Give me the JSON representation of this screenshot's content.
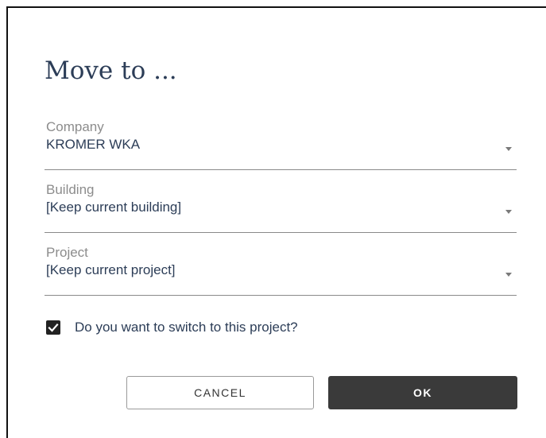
{
  "dialog": {
    "title": "Move to ..."
  },
  "fields": [
    {
      "label": "Company",
      "value": "KROMER WKA",
      "icon": "dropdown-arrow"
    },
    {
      "label": "Building",
      "value": "[Keep current building]",
      "icon": "dropdown-arrow"
    },
    {
      "label": "Project",
      "value": "[Keep current project]",
      "icon": "dropdown-arrow"
    }
  ],
  "switch_option": {
    "label": "Do you want to switch to this project?",
    "checked": true,
    "icon": "checkmark-icon"
  },
  "actions": {
    "cancel_label": "CANCEL",
    "ok_label": "OK"
  },
  "colors": {
    "text_primary": "#2c3d57",
    "label_gray": "#8c8c8c",
    "ok_button_bg": "#3a3a3a",
    "checkbox_bg": "#222222"
  }
}
